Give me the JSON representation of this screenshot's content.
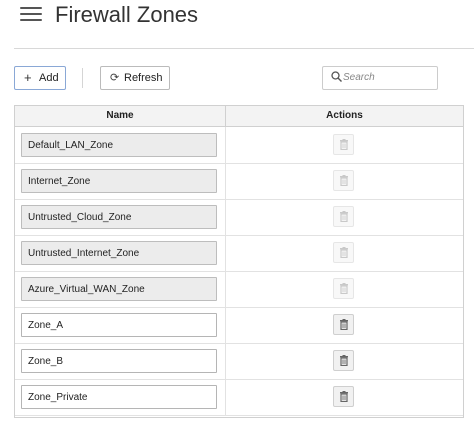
{
  "header": {
    "title": "Firewall Zones"
  },
  "toolbar": {
    "add_label": "Add",
    "refresh_label": "Refresh",
    "search_placeholder": "Search"
  },
  "table": {
    "columns": [
      "Name",
      "Actions"
    ],
    "rows": [
      {
        "name": "Default_LAN_Zone",
        "editable": false,
        "delete_enabled": false
      },
      {
        "name": "Internet_Zone",
        "editable": false,
        "delete_enabled": false
      },
      {
        "name": "Untrusted_Cloud_Zone",
        "editable": false,
        "delete_enabled": false
      },
      {
        "name": "Untrusted_Internet_Zone",
        "editable": false,
        "delete_enabled": false
      },
      {
        "name": "Azure_Virtual_WAN_Zone",
        "editable": false,
        "delete_enabled": false
      },
      {
        "name": "Zone_A",
        "editable": true,
        "delete_enabled": true
      },
      {
        "name": "Zone_B",
        "editable": true,
        "delete_enabled": true
      },
      {
        "name": "Zone_Private",
        "editable": true,
        "delete_enabled": true
      }
    ]
  },
  "icons": {
    "menu": "hamburger-menu-icon",
    "add": "plus-icon",
    "refresh": "refresh-icon",
    "search": "search-icon",
    "delete": "trash-icon"
  }
}
